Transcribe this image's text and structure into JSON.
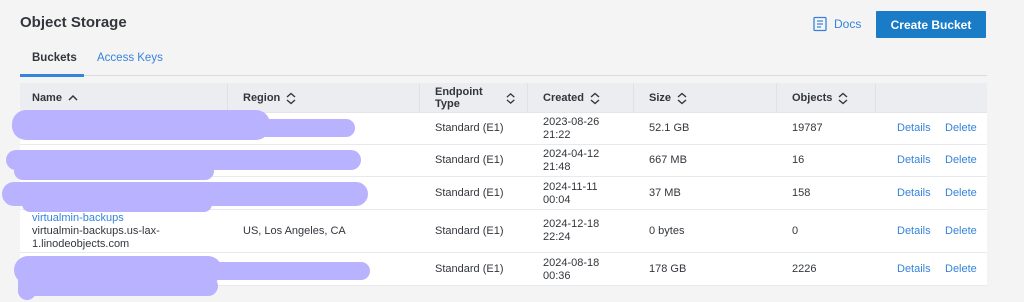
{
  "page": {
    "title": "Object Storage"
  },
  "header": {
    "docs_label": "Docs",
    "create_label": "Create Bucket"
  },
  "tabs": [
    {
      "label": "Buckets",
      "active": true
    },
    {
      "label": "Access Keys",
      "active": false
    }
  ],
  "table": {
    "columns": [
      "Name",
      "Region",
      "Endpoint Type",
      "Created",
      "Size",
      "Objects"
    ],
    "actions": {
      "details": "Details",
      "delete": "Delete"
    },
    "rows": [
      {
        "name": "",
        "hostname": "",
        "region": "",
        "endpoint": "Standard (E1)",
        "created_date": "2023-08-26",
        "created_time": "21:22",
        "size": "52.1 GB",
        "objects": "19787"
      },
      {
        "name": "",
        "hostname": "",
        "region": "",
        "endpoint": "Standard (E1)",
        "created_date": "2024-04-12",
        "created_time": "21:48",
        "size": "667 MB",
        "objects": "16"
      },
      {
        "name": "",
        "hostname": "",
        "region": "",
        "endpoint": "Standard (E1)",
        "created_date": "2024-11-11",
        "created_time": "00:04",
        "size": "37 MB",
        "objects": "158"
      },
      {
        "name": "virtualmin-backups",
        "hostname_1": "virtualmin-backups.us-lax-",
        "hostname_2": "1.linodeobjects.com",
        "region": "US, Los Angeles, CA",
        "endpoint": "Standard (E1)",
        "created_date": "2024-12-18",
        "created_time": "22:24",
        "size": "0 bytes",
        "objects": "0"
      },
      {
        "name": "",
        "hostname": "",
        "region": "",
        "endpoint": "Standard (E1)",
        "created_date": "2024-08-18",
        "created_time": "00:36",
        "size": "178 GB",
        "objects": "2226"
      }
    ]
  },
  "colors": {
    "accent": "#3683dc",
    "button": "#1a7bc7",
    "redaction": "#b9b2ff"
  }
}
